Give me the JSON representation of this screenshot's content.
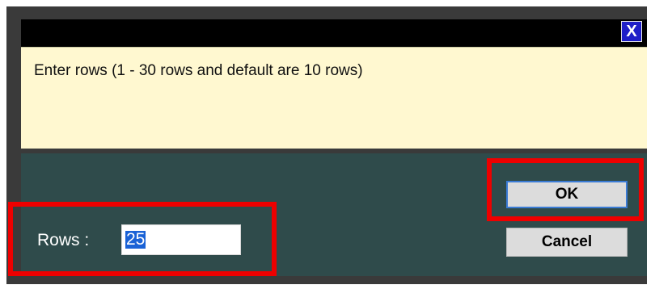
{
  "dialog": {
    "close_label": "X",
    "message": "Enter rows (1 - 30 rows and default are 10 rows)"
  },
  "form": {
    "rows_label": "Rows :",
    "rows_value": "25"
  },
  "buttons": {
    "ok_label": "OK",
    "cancel_label": "Cancel"
  },
  "colors": {
    "title_bar": "#000000",
    "message_background": "#fff8d0",
    "panel_background": "#2f4b4b",
    "selection": "#1a62d6",
    "highlight_outline": "#ee0000"
  }
}
